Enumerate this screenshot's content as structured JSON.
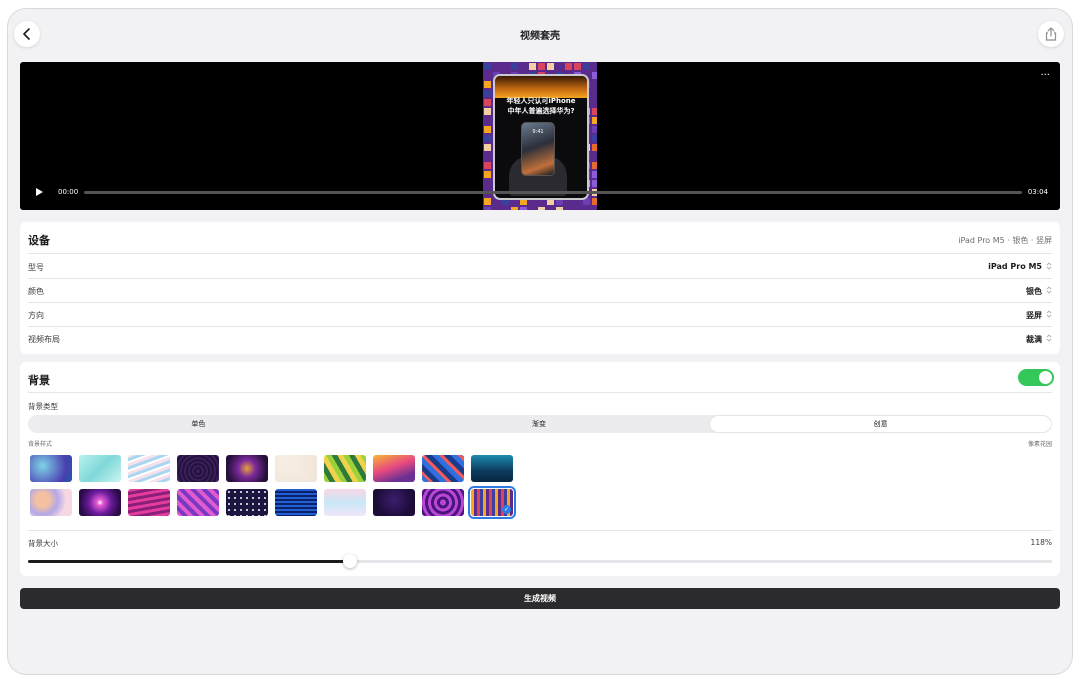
{
  "nav": {
    "title": "视频套壳"
  },
  "player": {
    "caption_line1": "年轻人只认可iPhone",
    "caption_line2": "中年人普遍选择华为?",
    "phone_time": "9:41",
    "current_time": "00:00",
    "duration": "03:04",
    "progress": 0,
    "more_label": "···"
  },
  "device": {
    "title": "设备",
    "summary": "iPad Pro M5 · 银色 · 竖屏",
    "rows": [
      {
        "label": "型号",
        "value": "iPad Pro M5"
      },
      {
        "label": "颜色",
        "value": "银色"
      },
      {
        "label": "方向",
        "value": "竖屏"
      },
      {
        "label": "视频布局",
        "value": "裁满"
      }
    ]
  },
  "background": {
    "title": "背景",
    "enabled": true,
    "type_label": "背景类型",
    "types": [
      "单色",
      "渐变",
      "创意"
    ],
    "selected_type": "创意",
    "style_label": "背景样式",
    "selected_style_name": "像素花园",
    "selected_index": 19,
    "size_label": "背景大小",
    "size_value": "118%",
    "size_fraction": 0.31
  },
  "actions": {
    "generate": "生成视频"
  },
  "colors": {
    "accent": "#34c759",
    "selection": "#2c7be5",
    "preview_bg": "#5a2a8c"
  },
  "icons": [
    "chevron-left-icon",
    "share-icon",
    "more-icon",
    "play-icon",
    "chevron-updown-icon",
    "checkmark-icon"
  ]
}
